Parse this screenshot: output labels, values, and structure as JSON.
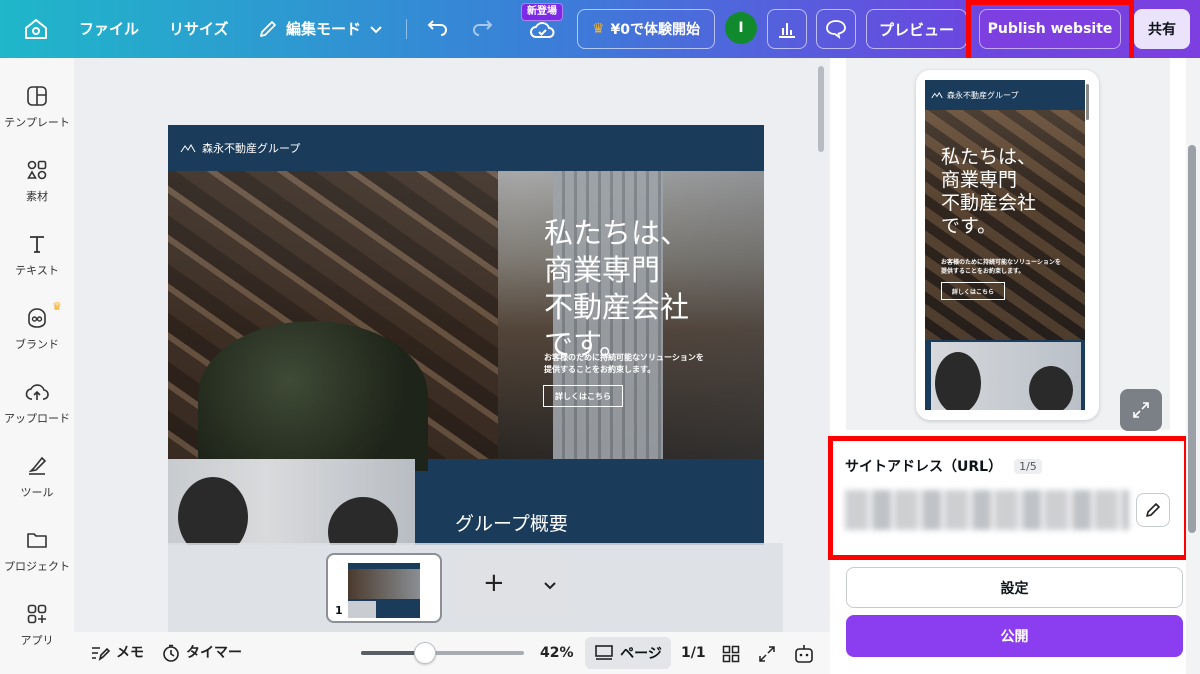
{
  "topbar": {
    "file": "ファイル",
    "resize": "リサイズ",
    "edit_mode": "編集モード",
    "new_badge": "新登場",
    "trial": "¥0で体験開始",
    "avatar_initial": "I",
    "preview": "プレビュー",
    "publish_website": "Publish website",
    "share": "共有"
  },
  "sidebar": {
    "items": [
      {
        "label": "テンプレート",
        "icon": "template-icon"
      },
      {
        "label": "素材",
        "icon": "elements-icon"
      },
      {
        "label": "テキスト",
        "icon": "text-icon"
      },
      {
        "label": "ブランド",
        "icon": "brand-icon"
      },
      {
        "label": "アップロード",
        "icon": "upload-icon"
      },
      {
        "label": "ツール",
        "icon": "tools-icon"
      },
      {
        "label": "プロジェクト",
        "icon": "folder-icon"
      },
      {
        "label": "アプリ",
        "icon": "apps-icon"
      }
    ]
  },
  "design": {
    "company": "森永不動産グループ",
    "hero_title_lines": [
      "私たちは、",
      "商業専門",
      "不動産会社",
      "です。"
    ],
    "hero_title": "私たちは、\n商業専門\n不動産会社\nです。",
    "hero_subtitle": "お客様のために持続可能なソリューションを\n提供することをお約束します。",
    "hero_button": "詳しくはこちら",
    "about_heading": "グループ概要"
  },
  "pages": {
    "thumb_number": "1"
  },
  "bottombar": {
    "notes": "メモ",
    "timer": "タイマー",
    "zoom": "42%",
    "zoom_value": 0.42,
    "pages_label": "ページ",
    "page_count": "1/1"
  },
  "rightpanel": {
    "url_label": "サイトアドレス（URL）",
    "url_count": "1/5",
    "settings": "設定",
    "publish": "公開"
  },
  "colors": {
    "accent": "#8b3df0",
    "highlight": "#ff0000",
    "design_navy": "#1a3b5a",
    "avatar": "#108a2d"
  }
}
